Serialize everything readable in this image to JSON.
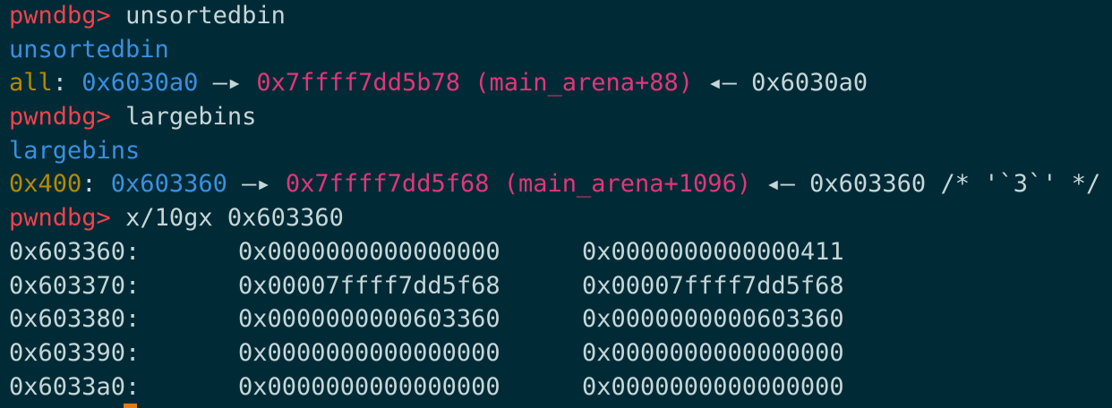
{
  "terminal": {
    "prompt": "pwndbg>",
    "commands": {
      "unsortedbin": "unsortedbin",
      "largebins": "largebins",
      "examine": "x/10gx 0x603360"
    },
    "unsortedbin_section": {
      "heading": "unsortedbin",
      "label": "all",
      "chunk_addr": "0x6030a0",
      "arrow": "—▸",
      "fd_addr": "0x7ffff7dd5b78",
      "fd_symbol": "(main_arena+88)",
      "back_arrow": "◂—",
      "bk_addr": "0x6030a0"
    },
    "largebins_section": {
      "heading": "largebins",
      "label": "0x400",
      "chunk_addr": "0x603360",
      "arrow": "—▸",
      "fd_addr": "0x7ffff7dd5f68",
      "fd_symbol": "(main_arena+1096)",
      "back_arrow": "◂—",
      "bk_addr": "0x603360",
      "comment": "/* '`3`' */"
    },
    "memory_dump": [
      {
        "addr": "0x603360:",
        "q1": "0x0000000000000000",
        "q2": "0x0000000000000411"
      },
      {
        "addr": "0x603370:",
        "q1": "0x00007ffff7dd5f68",
        "q2": "0x00007ffff7dd5f68"
      },
      {
        "addr": "0x603380:",
        "q1": "0x0000000000603360",
        "q2": "0x0000000000603360"
      },
      {
        "addr": "0x603390:",
        "q1": "0x0000000000000000",
        "q2": "0x0000000000000000"
      },
      {
        "addr": "0x6033a0:",
        "q1": "0x0000000000000000",
        "q2": "0x0000000000000000"
      }
    ]
  },
  "colors": {
    "background": "#002b36",
    "prompt": "#f0424b",
    "heading": "#3b8fe0",
    "label": "#b58900",
    "pointer_pink": "#e23579",
    "text": "#c6d6d8",
    "cursor": "#e07a16"
  }
}
